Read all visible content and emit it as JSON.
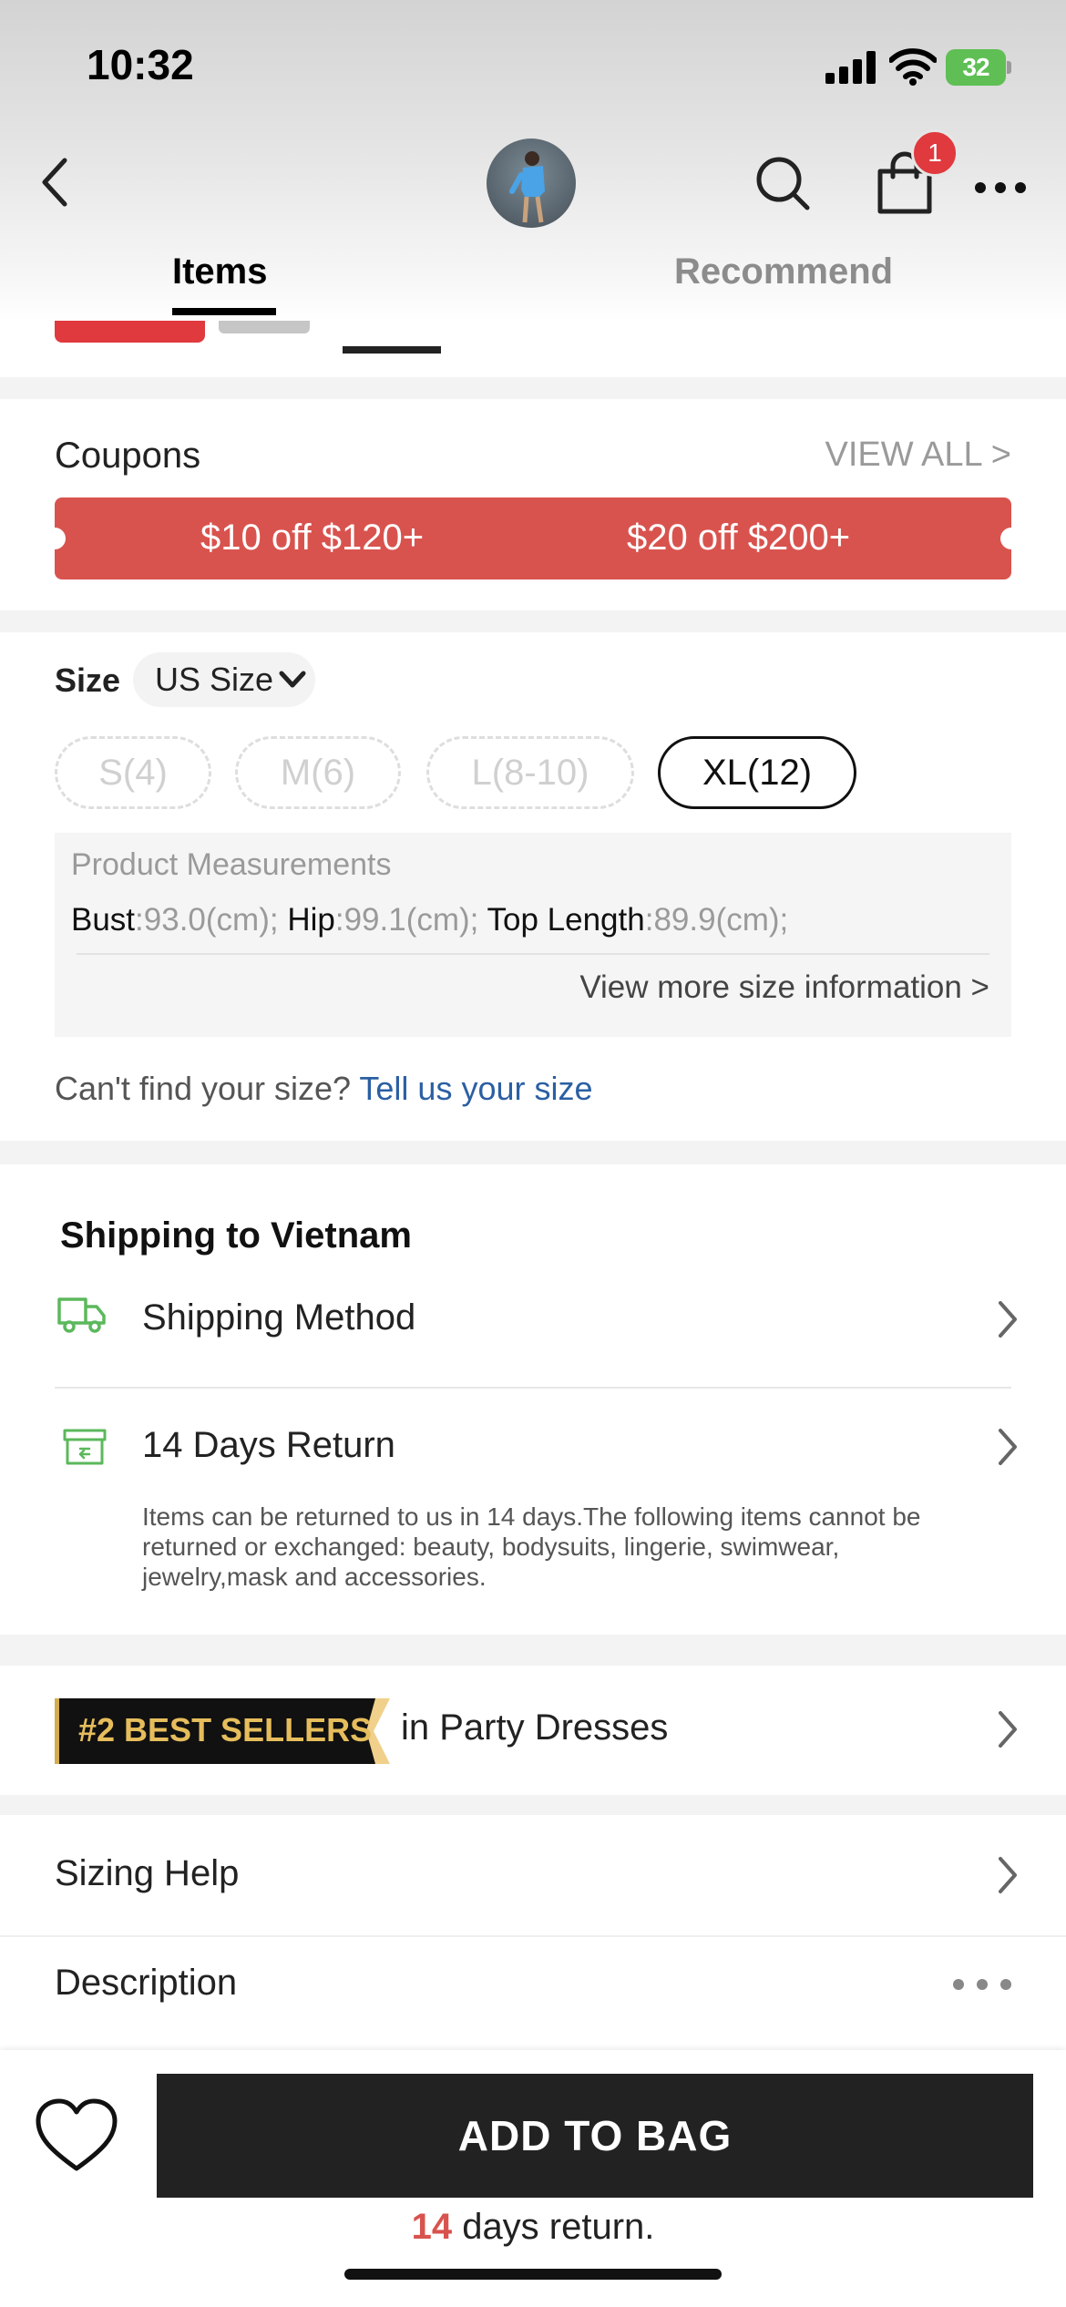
{
  "status_bar": {
    "time": "10:32",
    "battery": "32"
  },
  "header": {
    "cart_count": "1",
    "tabs": [
      {
        "label": "Items",
        "active": true
      },
      {
        "label": "Recommend",
        "active": false
      }
    ]
  },
  "coupons": {
    "title": "Coupons",
    "view_all": "VIEW ALL >",
    "items": [
      "$10 off $120+",
      "$20 off $200+"
    ],
    "color": "#d9534e"
  },
  "size": {
    "label": "Size",
    "system": "US Size",
    "options": [
      {
        "label": "S(4)",
        "available": false,
        "selected": false
      },
      {
        "label": "M(6)",
        "available": false,
        "selected": false
      },
      {
        "label": "L(8-10)",
        "available": false,
        "selected": false
      },
      {
        "label": "XL(12)",
        "available": true,
        "selected": true
      }
    ],
    "measurements": {
      "title": "Product Measurements",
      "items": [
        {
          "key": "Bust",
          "value": ":93.0(cm);"
        },
        {
          "key": "Hip",
          "value": ":99.1(cm);"
        },
        {
          "key": "Top Length",
          "value": ":89.9(cm);"
        }
      ],
      "more_link": "View more size information >"
    },
    "cant_find": "Can't find your size?",
    "tell_us": "Tell us your size"
  },
  "shipping": {
    "title": "Shipping to Vietnam",
    "method_label": "Shipping Method",
    "return_label": "14 Days Return",
    "return_desc": "Items can be returned to us in 14 days.The following items cannot be returned or exchanged: beauty, bodysuits, lingerie, swimwear, jewelry,mask and accessories.",
    "icon_color": "#5cb85c"
  },
  "best_sellers": {
    "badge": "#2 BEST SELLERS",
    "suffix": "in Party Dresses",
    "badge_color": "#e6bd5c"
  },
  "sections": {
    "sizing_help": "Sizing Help",
    "description": "Description"
  },
  "bottom_bar": {
    "add_to_bag": "ADD TO BAG",
    "return_days": "14",
    "return_text": " days return."
  }
}
